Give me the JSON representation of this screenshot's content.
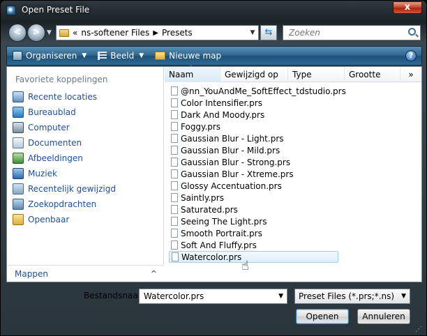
{
  "window": {
    "title": "Open Preset File",
    "close_label": "x"
  },
  "address": {
    "back_label": "<",
    "forward_label": ">",
    "crumb_prefix": "«",
    "crumbs": [
      "ns-softener Files",
      "Presets"
    ],
    "crumb_sep": "▶",
    "search_placeholder": "Zoeken"
  },
  "toolbar": {
    "organize_label": "Organiseren",
    "view_label": "Beeld",
    "new_folder_label": "Nieuwe map",
    "help_label": "?"
  },
  "favorites": {
    "title": "Favoriete koppelingen",
    "items": [
      {
        "label": "Recente locaties",
        "icon": "recent-places-icon"
      },
      {
        "label": "Bureaublad",
        "icon": "desktop-icon"
      },
      {
        "label": "Computer",
        "icon": "computer-icon"
      },
      {
        "label": "Documenten",
        "icon": "documents-icon"
      },
      {
        "label": "Afbeeldingen",
        "icon": "pictures-icon"
      },
      {
        "label": "Muziek",
        "icon": "music-icon"
      },
      {
        "label": "Recentelijk gewijzigd",
        "icon": "recently-changed-icon"
      },
      {
        "label": "Zoekopdrachten",
        "icon": "searches-icon"
      },
      {
        "label": "Openbaar",
        "icon": "public-folder-icon"
      }
    ],
    "folders_label": "Mappen"
  },
  "columns": {
    "name": "Naam",
    "date": "Gewijzigd op",
    "type": "Type",
    "size": "Grootte",
    "more": "»"
  },
  "files": [
    "@nn_YouAndMe_SoftEffect_tdstudio.prs",
    "Color Intensifier.prs",
    "Dark And Moody.prs",
    "Foggy.prs",
    "Gaussian Blur - Light.prs",
    "Gaussian Blur - Mild.prs",
    "Gaussian Blur - Strong.prs",
    "Gaussian Blur - Xtreme.prs",
    "Glossy Accentuation.prs",
    "Saintly.prs",
    "Saturated.prs",
    "Seeing The Light.prs",
    "Smooth Portrait.prs",
    "Soft And Fluffy.prs",
    "Watercolor.prs"
  ],
  "selected_file_index": 14,
  "bottom": {
    "filename_label": "Bestandsnaam:",
    "filename_value": "Watercolor.prs",
    "filetype_value": "Preset Files (*.prs;*.ns)",
    "open_label": "Openen",
    "cancel_label": "Annuleren"
  },
  "colors": {
    "link_blue": "#1e4fa4",
    "toolbar_blue": "#2f6690",
    "close_red": "#c6492c"
  }
}
